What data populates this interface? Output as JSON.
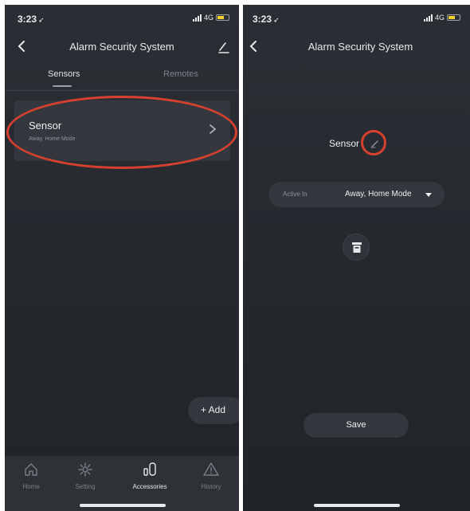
{
  "left": {
    "status": {
      "time": "3:23",
      "network": "4G"
    },
    "header": {
      "title": "Alarm Security System"
    },
    "tabs": [
      {
        "label": "Sensors"
      },
      {
        "label": "Remotes"
      }
    ],
    "sensor": {
      "name": "Sensor",
      "modes": "Away, Home Mode"
    },
    "add_label": "+ Add",
    "nav": [
      {
        "label": "Home",
        "icon": "home-icon"
      },
      {
        "label": "Setting",
        "icon": "gear-icon"
      },
      {
        "label": "Accessories",
        "icon": "accessories-icon"
      },
      {
        "label": "History",
        "icon": "warning-icon"
      }
    ]
  },
  "right": {
    "status": {
      "time": "3:23",
      "network": "4G"
    },
    "header": {
      "title": "Alarm Security System"
    },
    "sensor_name": "Sensor",
    "active_in": {
      "label": "Active In",
      "value": "Away, Home Mode"
    },
    "save_label": "Save"
  },
  "colors": {
    "background": "#25292e",
    "card": "#34383e",
    "highlight": "#d6402f",
    "battery": "#f2d12d"
  }
}
